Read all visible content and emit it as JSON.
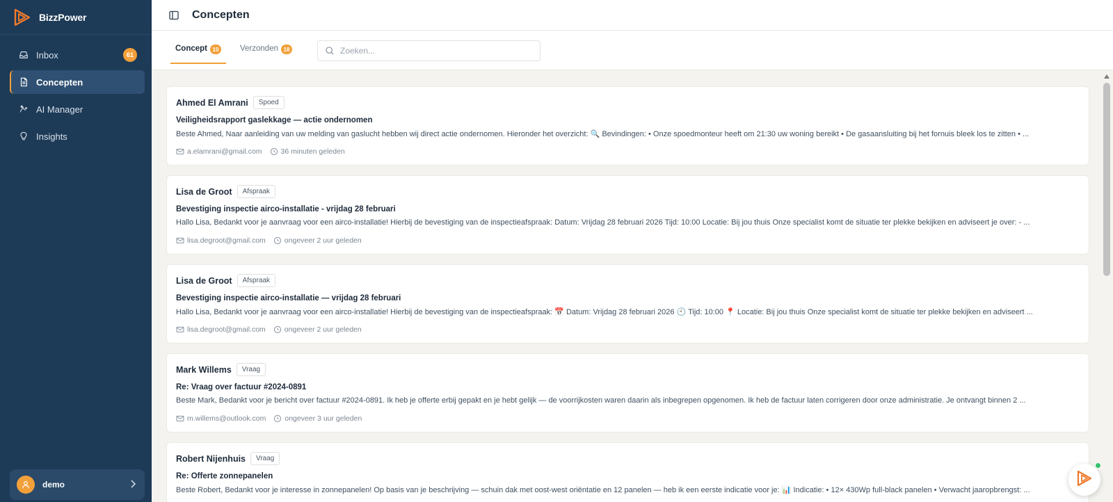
{
  "app": {
    "name": "BizzPower"
  },
  "colors": {
    "sidebar": "#1d3a57",
    "accent": "#f2a03a",
    "active_nav": "#2f5072",
    "online": "#34c06b"
  },
  "sidebar": {
    "items": [
      {
        "label": "Inbox",
        "icon": "inbox-icon",
        "badge": "61",
        "active": false
      },
      {
        "label": "Concepten",
        "icon": "document-icon",
        "active": true
      },
      {
        "label": "AI Manager",
        "icon": "sparkle-hand-icon",
        "active": false
      },
      {
        "label": "Insights",
        "icon": "lightbulb-icon",
        "active": false
      }
    ],
    "user": {
      "name": "demo",
      "icon": "user-icon"
    }
  },
  "header": {
    "title": "Concepten",
    "toggle_icon": "sidebar-toggle-icon"
  },
  "tabs": [
    {
      "label": "Concept",
      "count": "10",
      "active": true
    },
    {
      "label": "Verzonden",
      "count": "18",
      "active": false
    }
  ],
  "search": {
    "placeholder": "Zoeken...",
    "value": ""
  },
  "drafts": [
    {
      "sender": "Ahmed El Amrani",
      "tag": "Spoed",
      "subject": "Veiligheidsrapport gaslekkage — actie ondernomen",
      "preview": "Beste Ahmed, Naar aanleiding van uw melding van gaslucht hebben wij direct actie ondernomen. Hieronder het overzicht: 🔍 Bevindingen: • Onze spoedmonteur heeft om 21:30 uw woning bereikt • De gasaansluiting bij het fornuis bleek los te zitten • ...",
      "email": "a.elamrani@gmail.com",
      "time": "36 minuten geleden"
    },
    {
      "sender": "Lisa de Groot",
      "tag": "Afspraak",
      "subject": "Bevestiging inspectie airco-installatie - vrijdag 28 februari",
      "preview": "Hallo Lisa, Bedankt voor je aanvraag voor een airco-installatie! Hierbij de bevestiging van de inspectieafspraak: Datum: Vrijdag 28 februari 2026 Tijd: 10:00 Locatie: Bij jou thuis Onze specialist komt de situatie ter plekke bekijken en adviseert je over: - ...",
      "email": "lisa.degroot@gmail.com",
      "time": "ongeveer 2 uur geleden"
    },
    {
      "sender": "Lisa de Groot",
      "tag": "Afspraak",
      "subject": "Bevestiging inspectie airco-installatie — vrijdag 28 februari",
      "preview": "Hallo Lisa, Bedankt voor je aanvraag voor een airco-installatie! Hierbij de bevestiging van de inspectieafspraak: 📅 Datum: Vrijdag 28 februari 2026 🕙 Tijd: 10:00 📍 Locatie: Bij jou thuis Onze specialist komt de situatie ter plekke bekijken en adviseert ...",
      "email": "lisa.degroot@gmail.com",
      "time": "ongeveer 2 uur geleden"
    },
    {
      "sender": "Mark Willems",
      "tag": "Vraag",
      "subject": "Re: Vraag over factuur #2024-0891",
      "preview": "Beste Mark, Bedankt voor je bericht over factuur #2024-0891. Ik heb je offerte erbij gepakt en je hebt gelijk — de voorrijkosten waren daarin als inbegrepen opgenomen. Ik heb de factuur laten corrigeren door onze administratie. Je ontvangt binnen 2 ...",
      "email": "m.willems@outlook.com",
      "time": "ongeveer 3 uur geleden"
    },
    {
      "sender": "Robert Nijenhuis",
      "tag": "Vraag",
      "subject": "Re: Offerte zonnepanelen",
      "preview": "Beste Robert, Bedankt voor je interesse in zonnepanelen! Op basis van je beschrijving — schuin dak met oost-west oriëntatie en 12 panelen — heb ik een eerste indicatie voor je: 📊 Indicatie: • 12× 430Wp full-black panelen • Verwacht jaaropbrengst: ...",
      "email": "",
      "time": ""
    }
  ]
}
